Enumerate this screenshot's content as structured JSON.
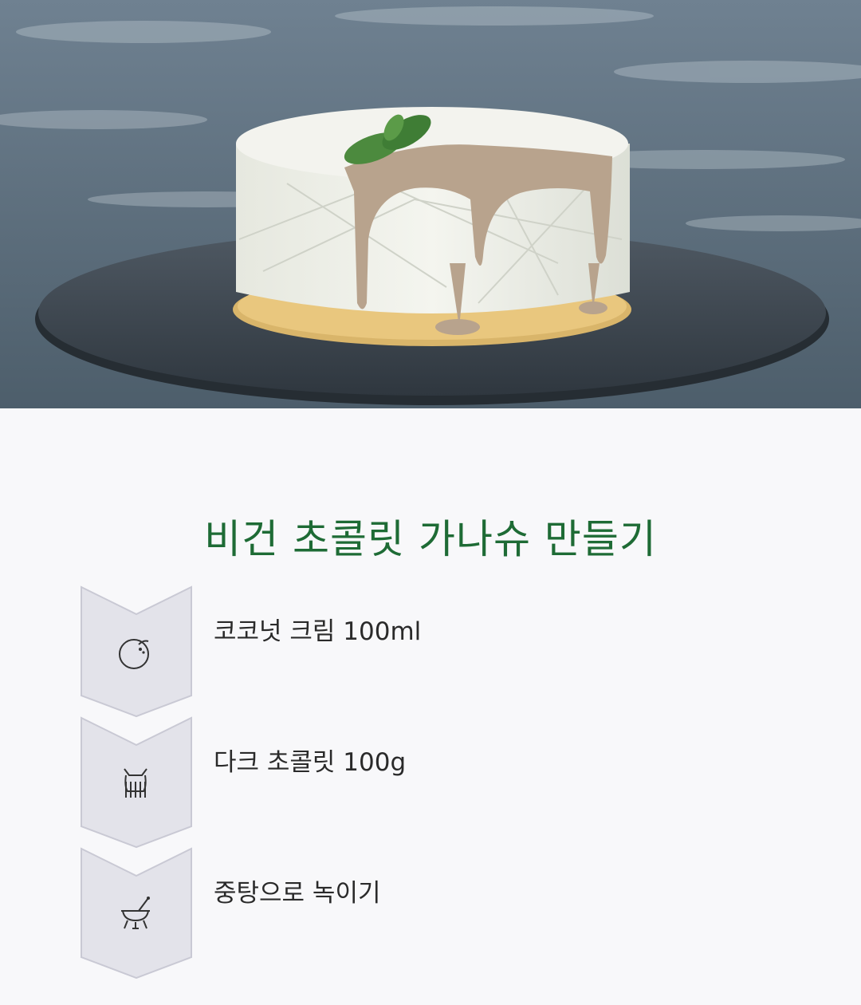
{
  "title": "비건 초콜릿 가나슈 만들기",
  "colors": {
    "title": "#1e6b35",
    "badge_fill": "#e3e3ea",
    "badge_stroke": "#c9c9d4",
    "background": "#f8f8fa"
  },
  "steps": [
    {
      "label": "코코넛 크림 100ml",
      "icon": "coconut-icon"
    },
    {
      "label": "다크 초콜릿 100g",
      "icon": "chocolate-bar-icon"
    },
    {
      "label": "중탕으로 녹이기",
      "icon": "double-boiler-icon"
    }
  ]
}
